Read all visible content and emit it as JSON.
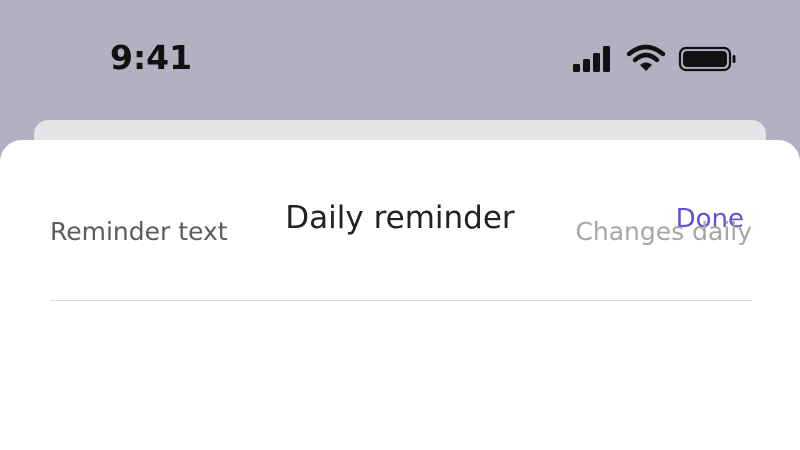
{
  "status_bar": {
    "time": "9:41",
    "icons": [
      "cellular-signal-icon",
      "wifi-icon",
      "battery-icon"
    ]
  },
  "sheet": {
    "title": "Daily reminder",
    "done_label": "Done",
    "rows": [
      {
        "label": "Reminder text",
        "value": "Changes daily"
      }
    ]
  },
  "colors": {
    "accent": "#6b4fd8",
    "backdrop": "#b3b1c1",
    "sheet_background": "#ffffff"
  }
}
